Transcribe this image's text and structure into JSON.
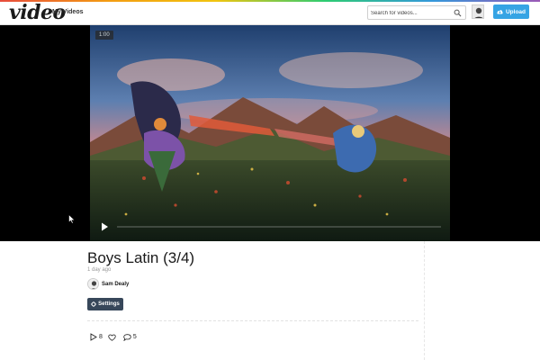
{
  "header": {
    "logo": "video",
    "nav_link": "My Videos",
    "search_placeholder": "Search for videos...",
    "upload_label": "Upload"
  },
  "player": {
    "timecode": "1:00",
    "progress": 0.0
  },
  "video": {
    "title": "Boys Latin (3/4)",
    "age": "1 day ago",
    "uploader": "Sam Dealy",
    "settings_label": "Settings"
  },
  "stats": {
    "plays": "8",
    "likes": "",
    "comments": "5"
  },
  "colors": {
    "accent": "#36a4e4",
    "settings_button": "#37475a"
  }
}
